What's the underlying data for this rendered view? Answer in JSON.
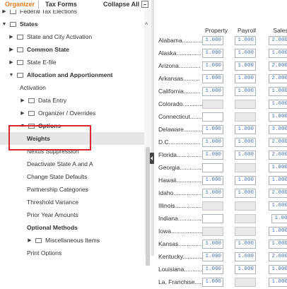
{
  "tabs": {
    "organizer": "Organizer",
    "tax_forms": "Tax Forms",
    "collapse_all": "Collapse All"
  },
  "tree": [
    {
      "label": "Federal Tax Elections",
      "indent": 0,
      "arrow": "right",
      "folder": true
    },
    {
      "label": "States",
      "indent": 0,
      "arrow": "down",
      "folder": true,
      "bold": true
    },
    {
      "label": "State and City Activation",
      "indent": 1,
      "arrow": "right",
      "folder": true
    },
    {
      "label": "Common State",
      "indent": 1,
      "arrow": "right",
      "folder": true,
      "bold": true
    },
    {
      "label": "State E-file",
      "indent": 1,
      "arrow": "right",
      "folder": true
    },
    {
      "label": "Allocation and Apportionment",
      "indent": 1,
      "arrow": "down",
      "folder": true,
      "bold": true
    },
    {
      "label": "Activation",
      "indent": 2,
      "arrow": "",
      "folder": false
    },
    {
      "label": "Data Entry",
      "indent": 2,
      "arrow": "right",
      "folder": true
    },
    {
      "label": "Organizer / Overrides",
      "indent": 2,
      "arrow": "right",
      "folder": true
    },
    {
      "label": "Options",
      "indent": 2,
      "arrow": "down",
      "folder": true,
      "bold": true
    },
    {
      "label": "Weights",
      "indent": 3,
      "arrow": "",
      "folder": false,
      "bold": true,
      "selected": true
    },
    {
      "label": "Nexus Suppression",
      "indent": 3,
      "arrow": "",
      "folder": false
    },
    {
      "label": "Deactivate State A and A",
      "indent": 3,
      "arrow": "",
      "folder": false
    },
    {
      "label": "Change State Defaults",
      "indent": 3,
      "arrow": "",
      "folder": false
    },
    {
      "label": "Partnership Categories",
      "indent": 3,
      "arrow": "",
      "folder": false
    },
    {
      "label": "Threshold Variance",
      "indent": 3,
      "arrow": "",
      "folder": false
    },
    {
      "label": "Prior Year Amounts",
      "indent": 3,
      "arrow": "",
      "folder": false
    },
    {
      "label": "Optional Methods",
      "indent": 3,
      "arrow": "",
      "folder": false,
      "bold": true
    },
    {
      "label": "Miscellaneous Items",
      "indent": 3,
      "arrow": "right",
      "folder": true
    },
    {
      "label": "Print Options",
      "indent": 3,
      "arrow": "",
      "folder": false
    }
  ],
  "columns": {
    "property": "Property",
    "payroll": "Payroll",
    "sales": "Sales"
  },
  "rows": [
    {
      "state": "Alabama............",
      "property": "1.000",
      "payroll": "1.000",
      "sales": "2.000"
    },
    {
      "state": "Alaska...............",
      "property": "1.000",
      "payroll": "1.000",
      "sales": "1.000"
    },
    {
      "state": "Arizona.............",
      "property": "1.000",
      "payroll": "1.000",
      "sales": "2.000"
    },
    {
      "state": "Arkansas..........",
      "property": "1.000",
      "payroll": "1.000",
      "sales": "2.000"
    },
    {
      "state": "California..........",
      "property": "1.000",
      "payroll": "1.000",
      "sales": "1.000"
    },
    {
      "state": "Colorado............",
      "property": "",
      "payroll": "",
      "sales": "1.000",
      "pd": true,
      "yd": true
    },
    {
      "state": "Connecticut.........",
      "property": "",
      "payroll": "",
      "sales": "1.000",
      "yd": true
    },
    {
      "state": "Delaware............",
      "property": "1.000",
      "payroll": "1.000",
      "sales": "3.000"
    },
    {
      "state": "D.C...................",
      "property": "1.000",
      "payroll": "1.000",
      "sales": "2.000"
    },
    {
      "state": "Florida...............",
      "property": "1.000",
      "payroll": "1.000",
      "sales": "2.000"
    },
    {
      "state": "Georgia...............",
      "property": "",
      "payroll": "",
      "sales": "1.000",
      "yd": true
    },
    {
      "state": "Hawaii................",
      "property": "1.000",
      "payroll": "1.000",
      "sales": "1.000"
    },
    {
      "state": "Idaho..................",
      "property": "1.000",
      "payroll": "1.000",
      "sales": "2.000"
    },
    {
      "state": "Illinois................",
      "property": "",
      "payroll": "",
      "sales": "1.000",
      "pd": true,
      "yd": true
    },
    {
      "state": "Indiana...............",
      "property": "",
      "payroll": "",
      "sales": "1.000",
      "yd": true,
      "sales_shift": true
    },
    {
      "state": "Iowa....................",
      "property": "",
      "payroll": "",
      "sales": "1.000",
      "pd": true,
      "yd": true
    },
    {
      "state": "Kansas...............",
      "property": "1.000",
      "payroll": "1.000",
      "sales": "1.000"
    },
    {
      "state": "Kentucky............",
      "property": "1.000",
      "payroll": "1.000",
      "sales": "2.000"
    },
    {
      "state": "Louisiana............",
      "property": "1.000",
      "payroll": "1.000",
      "sales": "1.000"
    },
    {
      "state": "La. Franchise......",
      "property": "1.000",
      "payroll": "",
      "sales": "1.000",
      "yd": true
    }
  ]
}
